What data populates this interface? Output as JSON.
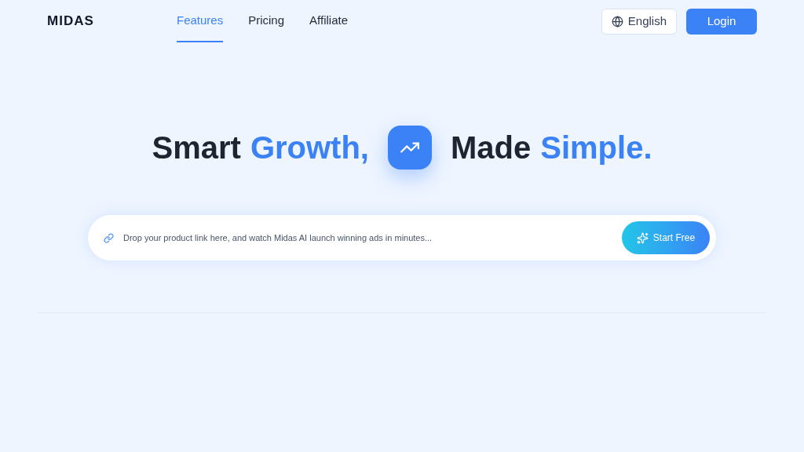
{
  "logo": "MIDAS",
  "nav": [
    {
      "label": "Features",
      "selected": true
    },
    {
      "label": "Pricing",
      "selected": false
    },
    {
      "label": "Affiliate",
      "selected": false
    }
  ],
  "language": "English",
  "login": "Login",
  "headline": {
    "before": [
      {
        "text": "Smart",
        "accent": false
      },
      {
        "text": "Growth,",
        "accent": true
      }
    ],
    "after": [
      {
        "text": "Made",
        "accent": false
      },
      {
        "text": "Simple.",
        "accent": true
      }
    ]
  },
  "link_input": {
    "placeholder": "Drop your product link here, and watch Midas AI launch winning ads in minutes..."
  },
  "cta": "Start Free"
}
